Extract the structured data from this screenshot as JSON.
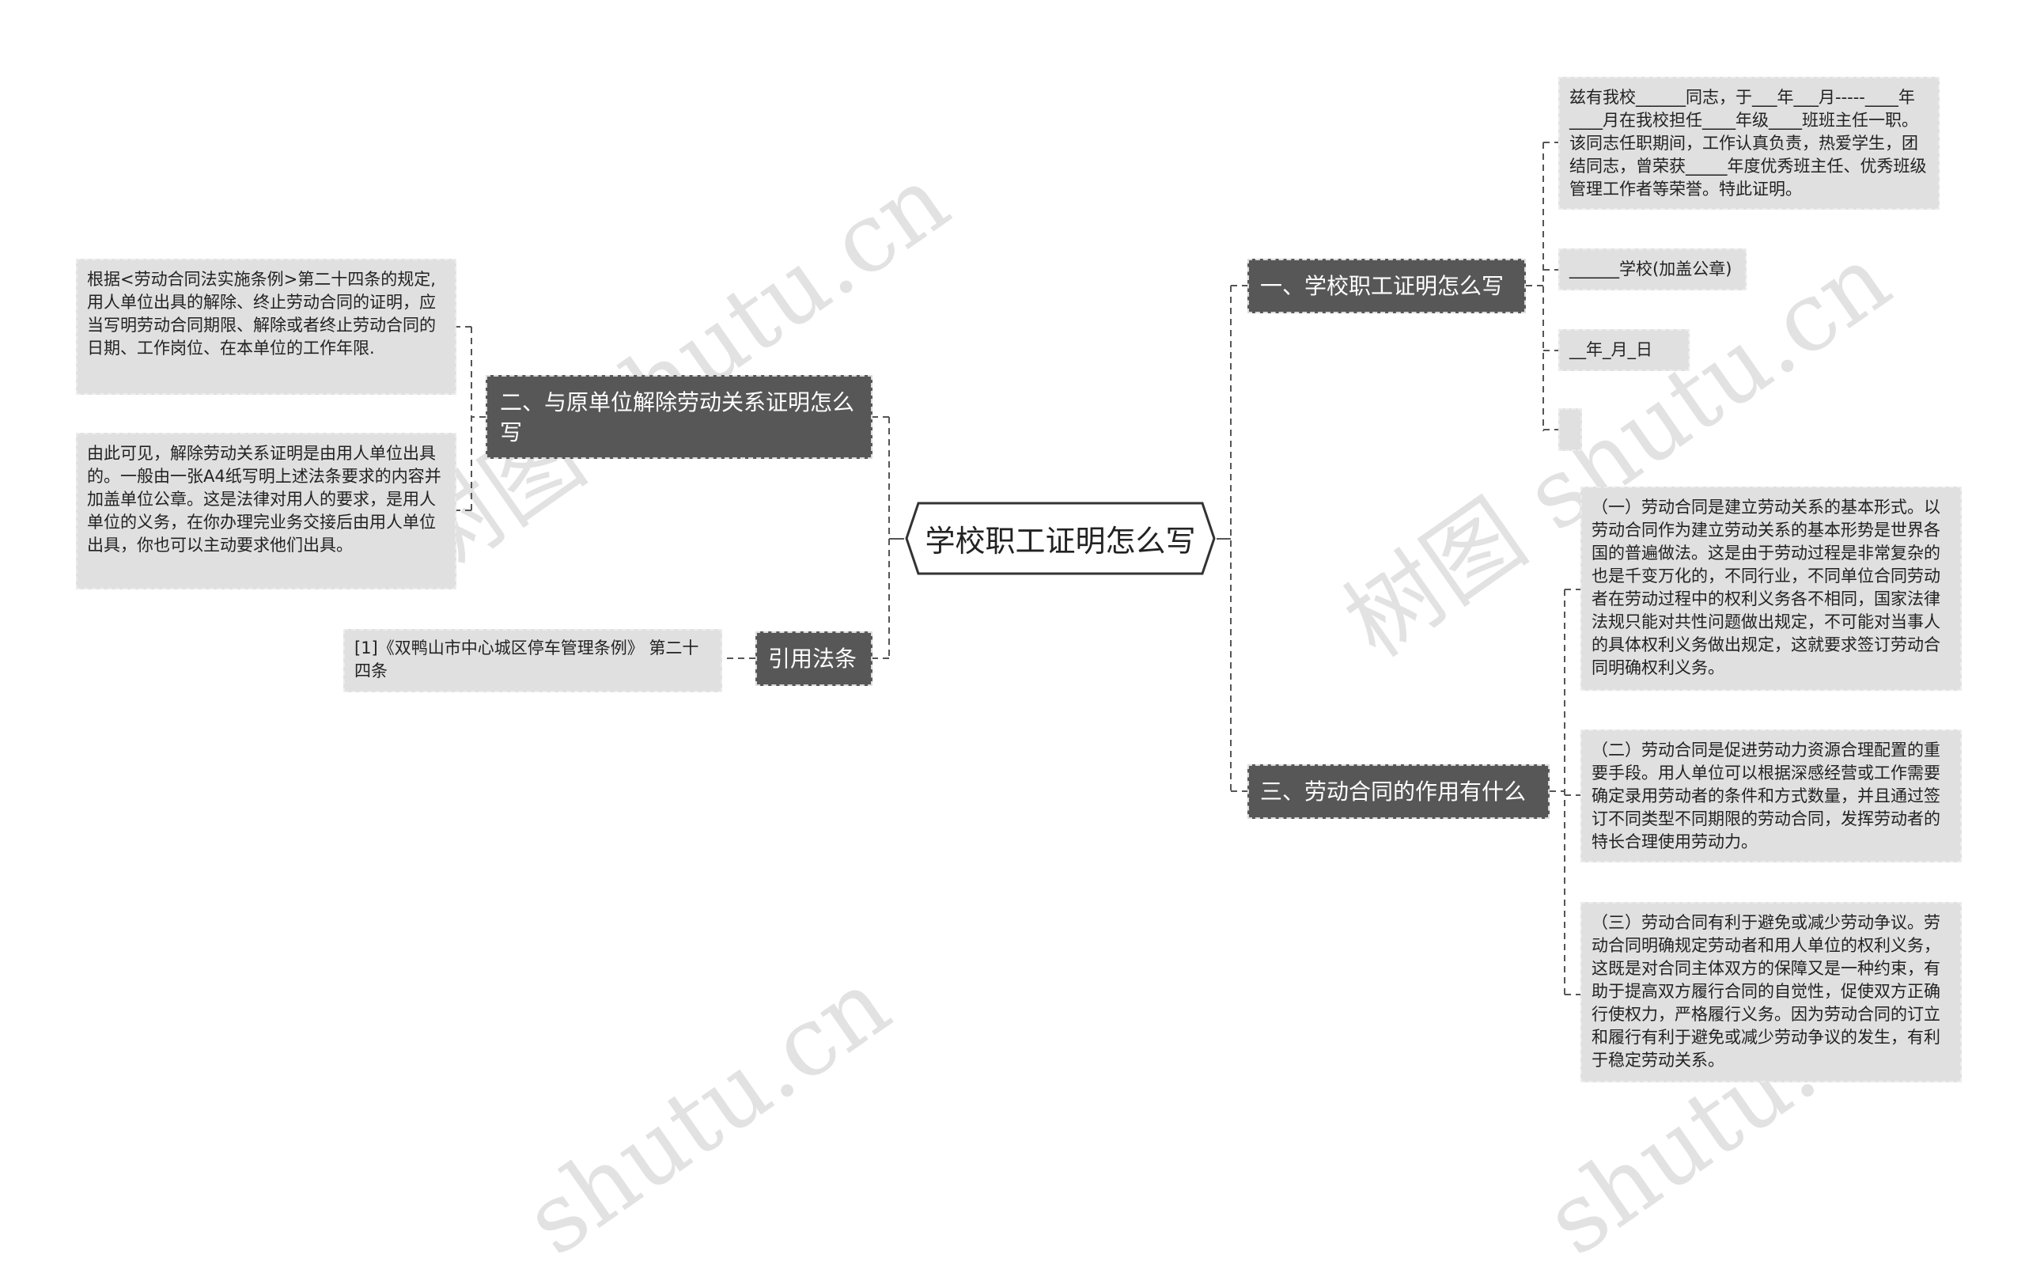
{
  "center": {
    "label": "学校职工证明怎么写"
  },
  "right": [
    {
      "label": "一、学校职工证明怎么写",
      "children": [
        "兹有我校______同志，于___年___月-----____年____月在我校担任____年级____班班主任一职。该同志任职期间，工作认真负责，热爱学生，团结同志，曾荣获_____年度优秀班主任、优秀班级管理工作者等荣誉。特此证明。",
        "______学校(加盖公章)",
        "__年_月_日",
        ""
      ]
    },
    {
      "label": "三、劳动合同的作用有什么",
      "children": [
        "（一）劳动合同是建立劳动关系的基本形式。以劳动合同作为建立劳动关系的基本形势是世界各国的普遍做法。这是由于劳动过程是非常复杂的也是千变万化的，不同行业，不同单位合同劳动者在劳动过程中的权利义务各不相同，国家法律法规只能对共性问题做出规定，不可能对当事人的具体权利义务做出规定，这就要求签订劳动合同明确权利义务。",
        "（二）劳动合同是促进劳动力资源合理配置的重要手段。用人单位可以根据深感经营或工作需要确定录用劳动者的条件和方式数量，并且通过签订不同类型不同期限的劳动合同，发挥劳动者的特长合理使用劳动力。",
        "（三）劳动合同有利于避免或减少劳动争议。劳动合同明确规定劳动者和用人单位的权利义务，这既是对合同主体双方的保障又是一种约束，有助于提高双方履行合同的自觉性，促使双方正确行使权力，严格履行义务。因为劳动合同的订立和履行有利于避免或减少劳动争议的发生，有利于稳定劳动关系。"
      ]
    }
  ],
  "left": [
    {
      "label": "二、与原单位解除劳动关系证明怎么写",
      "children": [
        "根据<劳动合同法实施条例>第二十四条的规定,用人单位出具的解除、终止劳动合同的证明，应当写明劳动合同期限、解除或者终止劳动合同的日期、工作岗位、在本单位的工作年限.",
        "由此可见，解除劳动关系证明是由用人单位出具的。一般由一张A4纸写明上述法条要求的内容并加盖单位公章。这是法律对用人的要求，是用人单位的义务，在你办理完业务交接后由用人单位出具，你也可以主动要求他们出具。"
      ]
    },
    {
      "label": "引用法条",
      "children": [
        "[1]《双鸭山市中心城区停车管理条例》 第二十四条"
      ]
    }
  ],
  "watermark": {
    "text_a": "树图 shutu.cn",
    "text_b": "shutu.cn"
  },
  "colors": {
    "topic_bg": "#575757",
    "leaf_bg": "#e0e0e0",
    "line": "#555555"
  }
}
